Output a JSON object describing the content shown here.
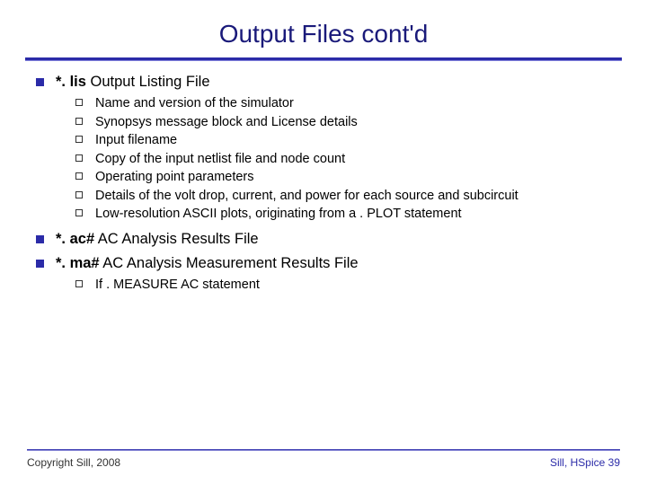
{
  "title": "Output Files cont'd",
  "sections": [
    {
      "heading_html": "<span class='strong'>*. lis</span> Output Listing File",
      "subs": [
        "Name and version of the simulator",
        "Synopsys message block and License details",
        "Input filename",
        "Copy of the input netlist file and node count",
        "Operating point parameters",
        "Details of the volt drop, current, and power for each source and subcircuit",
        "Low-resolution ASCII plots, originating from a . PLOT statement"
      ]
    },
    {
      "heading_html": "<span class='strong'>*. ac#</span> AC Analysis Results File",
      "subs": []
    },
    {
      "heading_html": "<span class='strong'>*. ma#</span> AC Analysis Measurement Results File",
      "subs": [
        "If . MEASURE AC statement"
      ]
    }
  ],
  "footer": {
    "copyright": "Copyright Sill, 2008",
    "right": "Sill, HSpice",
    "page": "39"
  }
}
